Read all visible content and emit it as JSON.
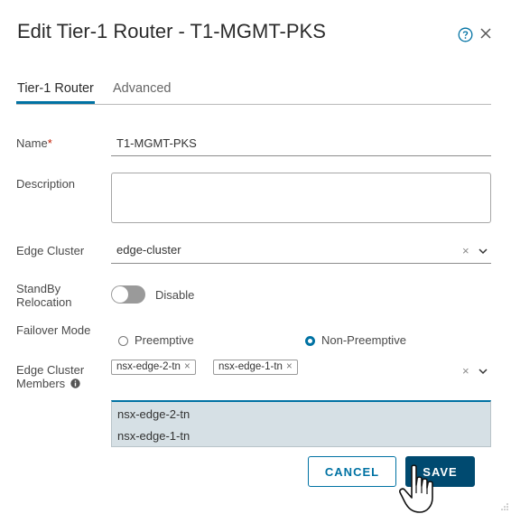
{
  "dialog": {
    "title": "Edit Tier-1 Router - T1-MGMT-PKS",
    "tabs": [
      {
        "label": "Tier-1 Router",
        "active": true
      },
      {
        "label": "Advanced",
        "active": false
      }
    ],
    "icons": {
      "help": "help-circle-icon",
      "close": "close-icon"
    }
  },
  "form": {
    "name": {
      "label": "Name",
      "required_mark": "*",
      "value": "T1-MGMT-PKS"
    },
    "description": {
      "label": "Description",
      "value": ""
    },
    "edge_cluster": {
      "label": "Edge Cluster",
      "value": "edge-cluster"
    },
    "standby_relocation": {
      "label_line1": "StandBy",
      "label_line2": "Relocation",
      "state": "Disable"
    },
    "failover_mode": {
      "label": "Failover Mode",
      "options": [
        "Preemptive",
        "Non-Preemptive"
      ],
      "selected": "Non-Preemptive"
    },
    "edge_cluster_members": {
      "label_line1": "Edge Cluster",
      "label_line2": "Members",
      "selected_chips": [
        "nsx-edge-2-tn",
        "nsx-edge-1-tn"
      ],
      "dropdown_options": [
        "nsx-edge-2-tn",
        "nsx-edge-1-tn"
      ]
    }
  },
  "buttons": {
    "cancel": "CANCEL",
    "save": "SAVE"
  },
  "colors": {
    "accent": "#0072a3",
    "primary_button": "#004a70",
    "required": "#c21d00",
    "dropdown_bg": "#d6e0e5"
  }
}
